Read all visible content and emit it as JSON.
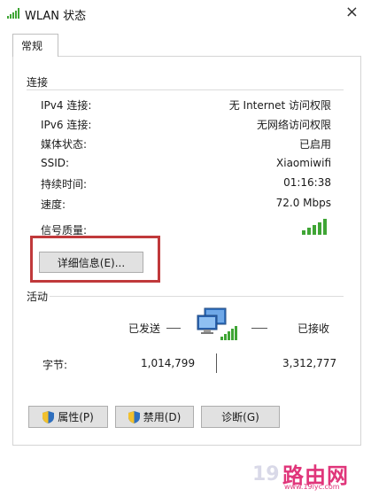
{
  "window": {
    "title": "WLAN 状态",
    "close_glyph": "×"
  },
  "tabs": [
    {
      "label": "常规",
      "active": true
    }
  ],
  "connection": {
    "section_label": "连接",
    "rows": [
      {
        "label": "IPv4 连接:",
        "value": "无 Internet 访问权限"
      },
      {
        "label": "IPv6 连接:",
        "value": "无网络访问权限"
      },
      {
        "label": "媒体状态:",
        "value": "已启用"
      },
      {
        "label": "SSID:",
        "value": "Xiaomiwifi"
      },
      {
        "label": "持续时间:",
        "value": "01:16:38"
      },
      {
        "label": "速度:",
        "value": "72.0 Mbps"
      }
    ],
    "signal_label": "信号质量:",
    "signal_icon": "signal-strength-icon",
    "details_button": "详细信息(E)..."
  },
  "activity": {
    "section_label": "活动",
    "sent_label": "已发送",
    "received_label": "已接收",
    "bytes_label": "字节:",
    "bytes_sent": "1,014,799",
    "bytes_received": "3,312,777",
    "network_icon": "network-computer-icon"
  },
  "buttons": {
    "properties": "属性(P)",
    "disable": "禁用(D)",
    "diagnose": "诊断(G)"
  },
  "watermark": {
    "number": "19",
    "brand": "路由网",
    "url": "www.19lyc.com"
  },
  "colors": {
    "highlight_box": "#c0393b",
    "signal_green": "#3fa535",
    "watermark_pink": "#e0357a"
  }
}
